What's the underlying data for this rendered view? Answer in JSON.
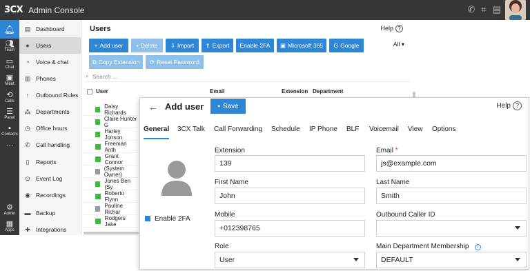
{
  "topbar": {
    "logo": "3CX",
    "title": "Admin Console"
  },
  "rail": [
    "Team",
    "Chat",
    "Meet",
    "Calls",
    "Panel",
    "Contacts",
    "Admin",
    "Apps"
  ],
  "nav": [
    {
      "label": "Dashboard",
      "icon": "dashboard-icon"
    },
    {
      "label": "Users",
      "icon": "user-icon"
    },
    {
      "label": "Voice & chat",
      "icon": "chat-icon"
    },
    {
      "label": "Phones",
      "icon": "phone-icon"
    },
    {
      "label": "Outbound Rules",
      "icon": "outbound-icon"
    },
    {
      "label": "Departments",
      "icon": "departments-icon"
    },
    {
      "label": "Office hours",
      "icon": "clock-icon"
    },
    {
      "label": "Call handling",
      "icon": "call-handling-icon"
    },
    {
      "label": "Reports",
      "icon": "reports-icon"
    },
    {
      "label": "Event Log",
      "icon": "event-log-icon"
    },
    {
      "label": "Recordings",
      "icon": "recordings-icon"
    },
    {
      "label": "Backup",
      "icon": "backup-icon"
    },
    {
      "label": "Integrations",
      "icon": "integrations-icon"
    }
  ],
  "users": {
    "title": "Users",
    "help": "Help",
    "buttons": [
      "Add user",
      "Delete",
      "Import",
      "Export",
      "Enable 2FA",
      "Microsoft 365",
      "Google"
    ],
    "buttons2": [
      "Copy Extension",
      "Reset Password"
    ],
    "all": "All",
    "search_placeholder": "Search ...",
    "columns": [
      "User",
      "Email",
      "Extension",
      "Department"
    ],
    "rows": [
      {
        "name": "Daisy Richards",
        "status": "green"
      },
      {
        "name": "Claire Hunter G",
        "status": "green"
      },
      {
        "name": "Harley Jonson",
        "status": "green"
      },
      {
        "name": "Freeman Anth",
        "status": "green"
      },
      {
        "name": "Grant Connor",
        "status": "green"
      },
      {
        "name": "(System Owner)",
        "status": "gray"
      },
      {
        "name": "Jones Ben (Sy",
        "status": "green"
      },
      {
        "name": "Roberto Flynn",
        "status": "green"
      },
      {
        "name": "Pauline Richar",
        "status": "gray"
      },
      {
        "name": "Rodgers Jake",
        "status": "green"
      }
    ]
  },
  "dialog": {
    "title": "Add user",
    "save": "Save",
    "help": "Help",
    "tabs": [
      "General",
      "3CX Talk",
      "Call Forwarding",
      "Schedule",
      "IP Phone",
      "BLF",
      "Voicemail",
      "View",
      "Options"
    ],
    "enable2fa": "Enable 2FA",
    "fields": {
      "extension": {
        "label": "Extension",
        "value": "139"
      },
      "email": {
        "label": "Email",
        "value": "js@example.com"
      },
      "first_name": {
        "label": "First Name",
        "value": "John"
      },
      "last_name": {
        "label": "Last Name",
        "value": "Smith"
      },
      "mobile": {
        "label": "Mobile",
        "value": "+012398765"
      },
      "outbound": {
        "label": "Outbound Caller ID",
        "value": ""
      },
      "role": {
        "label": "Role",
        "value": "User"
      },
      "department": {
        "label": "Main Department Membership",
        "value": "DEFAULT"
      }
    }
  },
  "colors": {
    "accent": "#2e87d6",
    "status_green": "#3db93d",
    "dark": "#353638"
  }
}
